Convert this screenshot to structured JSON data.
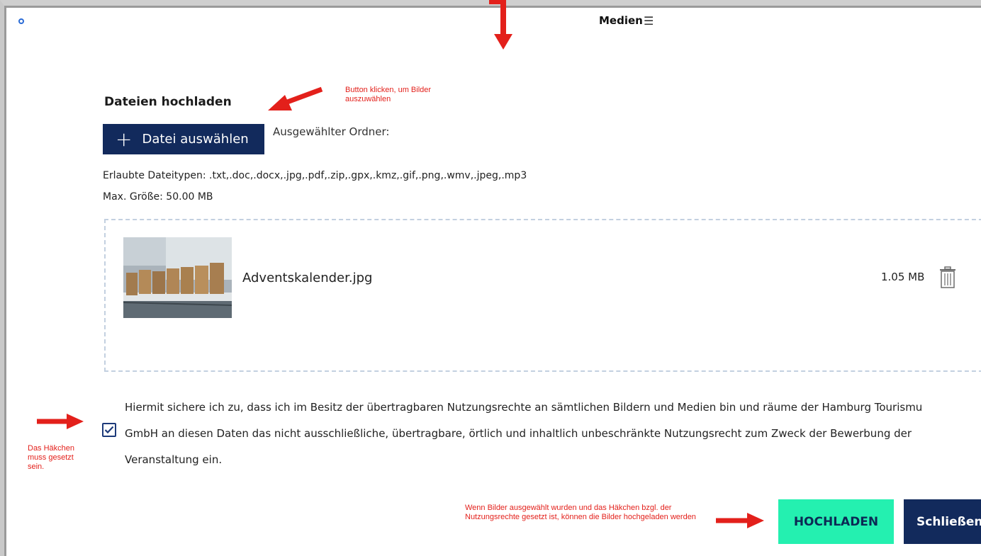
{
  "header": {
    "title": "Medien",
    "list_icon": "list-icon",
    "search_icon": "search-icon"
  },
  "upload": {
    "section_title": "Dateien hochladen",
    "choose_file_label": "Datei auswählen",
    "selected_folder_label": "Ausgewählter Ordner:",
    "allowed_types": "Erlaubte Dateitypen: .txt,.doc,.docx,.jpg,.pdf,.zip,.gpx,.kmz,.gif,.png,.wmv,.jpeg,.mp3",
    "max_size": "Max. Größe: 50.00 MB"
  },
  "files": [
    {
      "name": "Adventskalender.jpg",
      "size": "1.05 MB",
      "icon": "trash-icon"
    }
  ],
  "consent": {
    "checked": true,
    "line1": "Hiermit sichere ich zu, dass ich im Besitz der übertragbaren Nutzungsrechte an sämtlichen Bildern und Medien bin und räume der Hamburg Tourismu",
    "line2": "GmbH an diesen Daten das nicht ausschließliche, übertragbare, örtlich und inhaltlich unbeschränkte Nutzungsrecht zum Zweck der Bewerbung der",
    "line3": "Veranstaltung ein."
  },
  "actions": {
    "upload_label": "HOCHLADEN",
    "close_label": "Schließen"
  },
  "annotations": {
    "note_button": "Button klicken, um Bilder auszuwählen",
    "note_checkbox": "Das Häkchen muss gesetzt sein.",
    "note_upload": "Wenn Bilder ausgewählt wurden und das Häkchen bzgl. der Nutzungsrechte gesetzt ist, können die Bilder hochgeladen werden"
  },
  "colors": {
    "primary": "#122a5c",
    "accent": "#24f0b0",
    "annotation": "#e3201b"
  }
}
